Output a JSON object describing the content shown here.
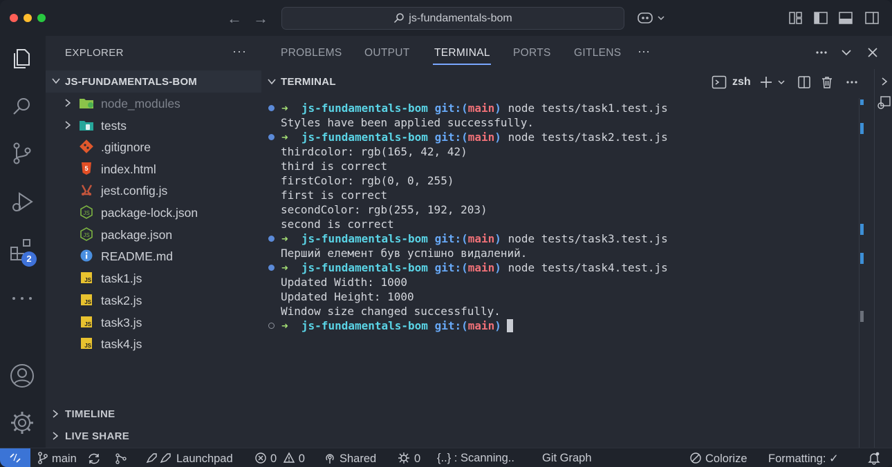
{
  "titlebar": {
    "search_text": "js-fundamentals-bom",
    "back_icon": "arrow-left-icon",
    "forward_icon": "arrow-right-icon"
  },
  "activity_bar": {
    "items": [
      "explorer-icon",
      "search-icon",
      "source-control-icon",
      "run-debug-icon",
      "extensions-icon",
      "more-icon"
    ],
    "extensions_badge": "2",
    "bottom": [
      "account-icon",
      "settings-gear-icon"
    ]
  },
  "sidebar": {
    "title": "EXPLORER",
    "more": "···",
    "project": "JS-FUNDAMENTALS-BOM",
    "tree": [
      {
        "name": "node_modules",
        "type": "folder"
      },
      {
        "name": "tests",
        "type": "folder"
      },
      {
        "name": ".gitignore",
        "type": "git"
      },
      {
        "name": "index.html",
        "type": "html"
      },
      {
        "name": "jest.config.js",
        "type": "jest"
      },
      {
        "name": "package-lock.json",
        "type": "node"
      },
      {
        "name": "package.json",
        "type": "node"
      },
      {
        "name": "README.md",
        "type": "info"
      },
      {
        "name": "task1.js",
        "type": "js"
      },
      {
        "name": "task2.js",
        "type": "js"
      },
      {
        "name": "task3.js",
        "type": "js"
      },
      {
        "name": "task4.js",
        "type": "js"
      }
    ],
    "timeline": "TIMELINE",
    "live_share": "LIVE SHARE"
  },
  "panel": {
    "tabs": [
      "PROBLEMS",
      "OUTPUT",
      "TERMINAL",
      "PORTS",
      "GITLENS"
    ],
    "active_tab": "TERMINAL",
    "more": "···",
    "terminal_header": "TERMINAL",
    "shell": "zsh",
    "prompt": {
      "arrow": "➜",
      "dir": "js-fundamentals-bom",
      "git": "git:(",
      "branch": "main",
      "git_close": ")"
    },
    "lines": [
      {
        "kind": "prompt",
        "cmd": "node tests/task1.test.js",
        "status": "done"
      },
      {
        "kind": "out",
        "text": "Styles have been applied successfully."
      },
      {
        "kind": "prompt",
        "cmd": "node tests/task2.test.js",
        "status": "done"
      },
      {
        "kind": "out",
        "text": "thirdcolor: rgb(165, 42, 42)"
      },
      {
        "kind": "out",
        "text": "third is correct"
      },
      {
        "kind": "out",
        "text": "firstColor: rgb(0, 0, 255)"
      },
      {
        "kind": "out",
        "text": "first is correct"
      },
      {
        "kind": "out",
        "text": "secondColor: rgb(255, 192, 203)"
      },
      {
        "kind": "out",
        "text": "second is correct"
      },
      {
        "kind": "prompt",
        "cmd": "node tests/task3.test.js",
        "status": "done"
      },
      {
        "kind": "out",
        "text": "Перший елемент був успішно видалений."
      },
      {
        "kind": "prompt",
        "cmd": "node tests/task4.test.js",
        "status": "done"
      },
      {
        "kind": "out",
        "text": "Updated Width: 1000"
      },
      {
        "kind": "out",
        "text": "Updated Height: 1000"
      },
      {
        "kind": "out",
        "text": "Window size changed successfully."
      },
      {
        "kind": "prompt",
        "cmd": "",
        "status": "current"
      }
    ]
  },
  "statusbar": {
    "branch": "main",
    "launchpad": "Launchpad",
    "errors": "0",
    "warnings": "0",
    "shared": "Shared",
    "ports": "0",
    "scanning": "{..} : Scanning..",
    "git_graph": "Git Graph",
    "colorize": "Colorize",
    "formatting": "Formatting: ✓"
  },
  "colors": {
    "accent": "#3b74d6",
    "prompt_arrow": "#a5e075",
    "prompt_dir": "#5ad4e6",
    "prompt_git": "#68a9f7",
    "prompt_branch": "#f07178"
  }
}
